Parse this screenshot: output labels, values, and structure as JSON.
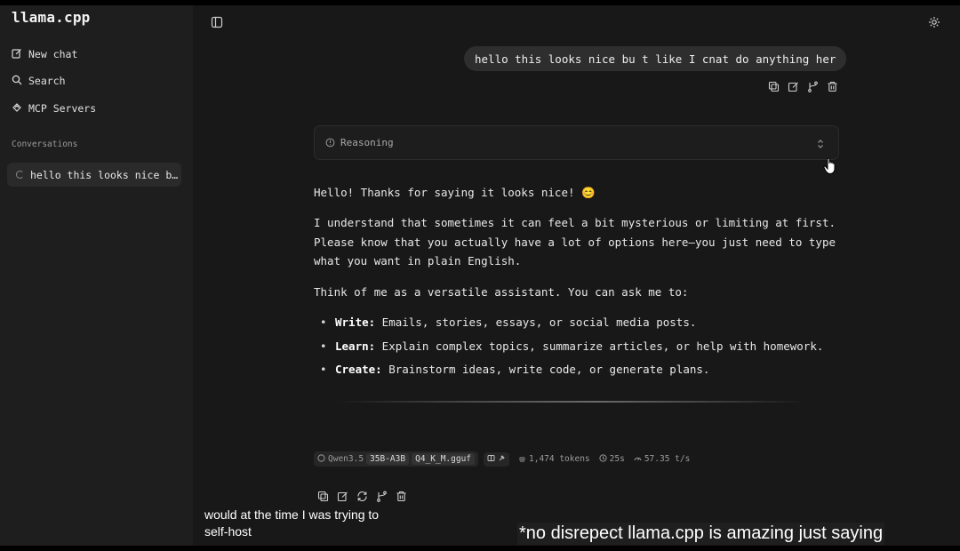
{
  "app": {
    "title": "llama.cpp"
  },
  "sidebar": {
    "items": [
      {
        "label": "New chat",
        "icon": "edit-icon"
      },
      {
        "label": "Search",
        "icon": "search-icon"
      },
      {
        "label": "MCP Servers",
        "icon": "mcp-icon"
      }
    ],
    "section_label": "Conversations",
    "conversations": [
      {
        "label": "hello this looks nice b…",
        "status": "loading"
      }
    ]
  },
  "chat": {
    "user_message": "hello this looks nice bu t like I cnat do anything her",
    "reasoning_label": "Reasoning",
    "answer": {
      "p1": "Hello! Thanks for saying it looks nice! 😊",
      "p2": "I understand that sometimes it can feel a bit mysterious or limiting at first. Please know that you actually have a lot of options here—you just need to type what you want in plain English.",
      "p3": "Think of me as a versatile assistant. You can ask me to:",
      "bullets": [
        {
          "term": "Write:",
          "text": " Emails, stories, essays, or social media posts."
        },
        {
          "term": "Learn:",
          "text": " Explain complex topics, summarize articles, or help with homework."
        },
        {
          "term": "Create:",
          "text": " Brainstorm ideas, write code, or generate plans."
        }
      ]
    },
    "meta": {
      "model_family": "Qwen3.5",
      "model_size": "35B-A3B",
      "quant_file": "Q4_K_M.gguf",
      "tokens": "1,474 tokens",
      "duration": "25s",
      "speed": "57.35 t/s"
    }
  },
  "captions": {
    "left": [
      "would at the time I was trying to",
      "self-host"
    ],
    "right": "*no disrepect llama.cpp is amazing just saying"
  }
}
